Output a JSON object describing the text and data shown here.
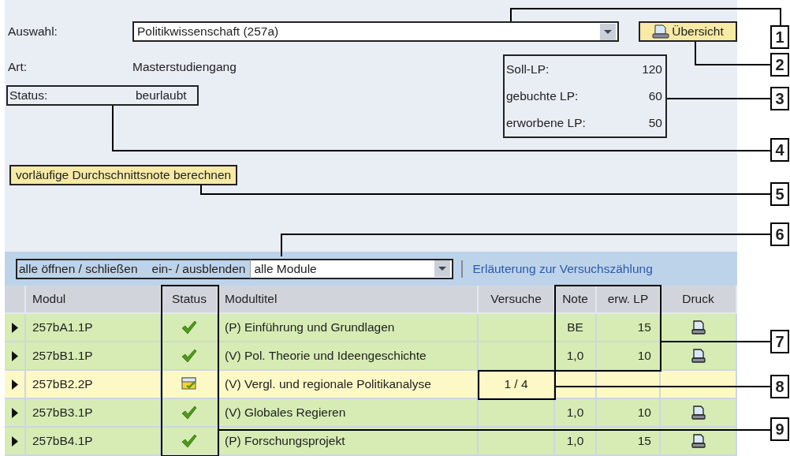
{
  "selection": {
    "label": "Auswahl:",
    "value": "Politikwissenschaft (257a)"
  },
  "overview_button": "Übersicht",
  "type": {
    "label": "Art:",
    "value": "Masterstudiengang"
  },
  "status": {
    "label": "Status:",
    "value": "beurlaubt"
  },
  "credits": [
    {
      "label": "Soll-LP:",
      "value": "120"
    },
    {
      "label": "gebuchte LP:",
      "value": "60"
    },
    {
      "label": "erworbene LP:",
      "value": "50"
    }
  ],
  "average_button": "vorläufige Durchschnittsnote berechnen",
  "toolbar": {
    "toggle_all": "alle öffnen / schließen",
    "show_hide": "ein- / ausblenden",
    "filter": "alle Module",
    "help_link": "Erläuterung zur Versuchszählung"
  },
  "table": {
    "columns": [
      "Modul",
      "Status",
      "Modultitel",
      "Versuche",
      "Note",
      "erw. LP",
      "Druck"
    ],
    "rows": [
      {
        "module": "257bA1.1P",
        "completed": true,
        "title": "(P) Einführung und Grundlagen",
        "grade": "BE",
        "credits": "15",
        "printable": true
      },
      {
        "module": "257bB1.1P",
        "completed": true,
        "title": "(V) Pol. Theorie und Ideengeschichte",
        "grade": "1,0",
        "credits": "10",
        "printable": true
      },
      {
        "module": "257bB2.2P",
        "completed": false,
        "title": "(V) Vergl. und regionale Politikanalyse",
        "attempts": "1 /  4",
        "printable": false
      },
      {
        "module": "257bB3.1P",
        "completed": true,
        "title": "(V) Globales Regieren",
        "grade": "1,0",
        "credits": "10",
        "printable": true
      },
      {
        "module": "257bB4.1P",
        "completed": true,
        "title": "(P) Forschungsprojekt",
        "grade": "1,0",
        "credits": "15",
        "printable": true
      }
    ]
  },
  "callouts": [
    "1",
    "2",
    "3",
    "4",
    "5",
    "6",
    "7",
    "8",
    "9"
  ]
}
